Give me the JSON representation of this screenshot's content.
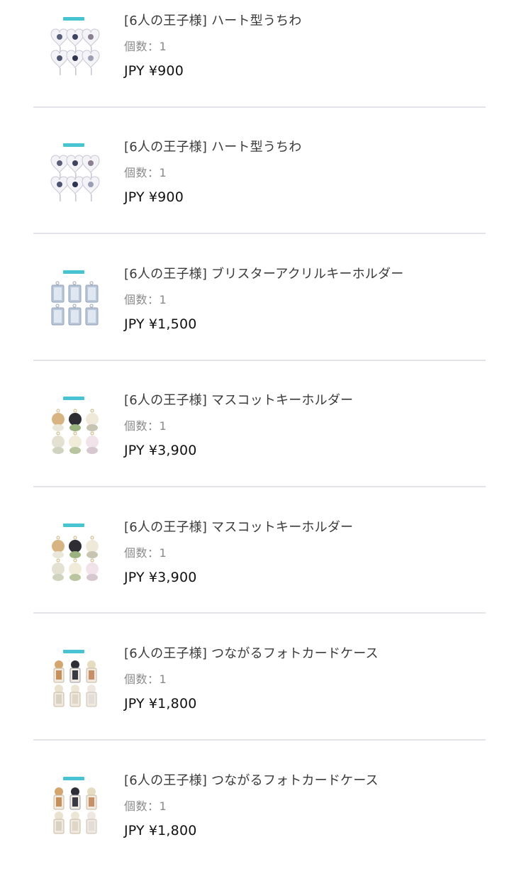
{
  "colors": {
    "divider": "#e3e3ea",
    "name_text": "#3a3a3a",
    "qty_text": "#8a8a8a",
    "price_text": "#111111",
    "thumb_badge": "#27b9c9"
  },
  "cart": {
    "items": [
      {
        "name": "[6人の王子様] ハート型うちわ",
        "quantity": "個数：1",
        "currency": "JPY",
        "price": "¥900",
        "thumbnail": "heart-uchiwa-product-icon"
      },
      {
        "name": "[6人の王子様] ハート型うちわ",
        "quantity": "個数：1",
        "currency": "JPY",
        "price": "¥900",
        "thumbnail": "heart-uchiwa-product-icon"
      },
      {
        "name": "[6人の王子様] ブリスターアクリルキーホルダー",
        "quantity": "個数：1",
        "currency": "JPY",
        "price": "¥1,500",
        "thumbnail": "acrylic-keyholder-product-icon"
      },
      {
        "name": "[6人の王子様] マスコットキーホルダー",
        "quantity": "個数：1",
        "currency": "JPY",
        "price": "¥3,900",
        "thumbnail": "mascot-keyholder-product-icon"
      },
      {
        "name": "[6人の王子様] マスコットキーホルダー",
        "quantity": "個数：1",
        "currency": "JPY",
        "price": "¥3,900",
        "thumbnail": "mascot-keyholder-product-icon"
      },
      {
        "name": "[6人の王子様] つながるフォトカードケース",
        "quantity": "個数：1",
        "currency": "JPY",
        "price": "¥1,800",
        "thumbnail": "photocard-case-product-icon"
      },
      {
        "name": "[6人の王子様] つながるフォトカードケース",
        "quantity": "個数：1",
        "currency": "JPY",
        "price": "¥1,800",
        "thumbnail": "photocard-case-product-icon"
      }
    ]
  }
}
